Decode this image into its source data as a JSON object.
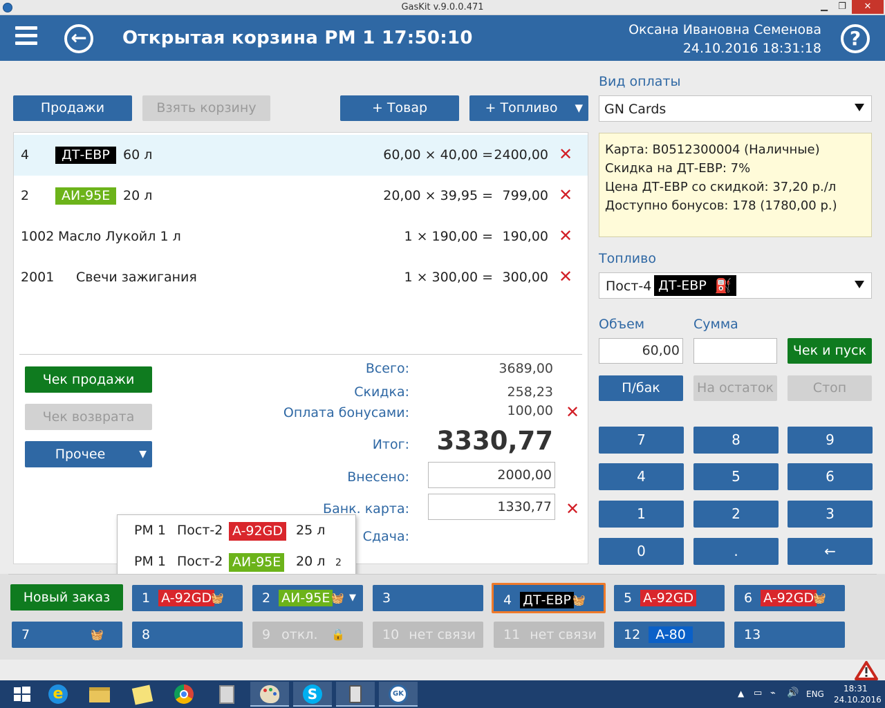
{
  "window": {
    "title": "GasKit v.9.0.0.471"
  },
  "header": {
    "title": "Открытая корзина  РМ 1  17:50:10",
    "user": "Оксана Ивановна Семенова",
    "datetime": "24.10.2016 18:31:18",
    "back_glyph": "←",
    "help_glyph": "?"
  },
  "toolbar": {
    "sales": "Продажи",
    "take_cart": "Взять корзину",
    "add_goods": "+ Товар",
    "add_fuel": "+ Топливо"
  },
  "cart": {
    "items": [
      {
        "code": "4",
        "badge": "ДТ-ЕВР",
        "name": "60 л",
        "calc": "60,00 × 40,00 =",
        "sum": "2400,00"
      },
      {
        "code": "2",
        "badge": "АИ-95Е",
        "name": "20 л",
        "calc": "20,00 × 39,95 =",
        "sum": "799,00"
      },
      {
        "code": "1002",
        "badge": "",
        "name": "Масло Лукойл 1 л",
        "calc": "1 × 190,00 =",
        "sum": "190,00"
      },
      {
        "code": "2001",
        "badge": "",
        "name": "Свечи зажигания",
        "calc": "1 × 300,00 =",
        "sum": "300,00"
      }
    ],
    "remove_glyph": "✕"
  },
  "actions": {
    "sale_receipt": "Чек продажи",
    "return_receipt": "Чек возврата",
    "other": "Прочее"
  },
  "totals": {
    "total_label": "Всего:",
    "total": "3689,00",
    "discount_label": "Скидка:",
    "discount": "258,23",
    "bonus_label": "Оплата бонусами:",
    "bonus": "100,00",
    "result_label": "Итог:",
    "result": "3330,77",
    "paid_label": "Внесено:",
    "paid": "2000,00",
    "card_label": "Банк. карта:",
    "card": "1330,77",
    "change_label": "Сдача:"
  },
  "popup": {
    "rows": [
      {
        "rm": "РМ 1",
        "post": "Пост-2",
        "fuel": "A-92GD",
        "vol": "25 л",
        "extra": ""
      },
      {
        "rm": "РМ 1",
        "post": "Пост-2",
        "fuel": "АИ-95Е",
        "vol": "20 л",
        "extra": "2"
      }
    ]
  },
  "payment": {
    "label": "Вид оплаты",
    "selected": "GN Cards",
    "info": [
      "Карта: B0512300004 (Наличные)",
      "Скидка на ДТ-ЕВР: 7%",
      "Цена ДТ-ЕВР со скидкой: 37,20 р./л",
      "Доступно бонусов: 178 (1780,00 р.)"
    ]
  },
  "fuel": {
    "label": "Топливо",
    "post": "Пост-4",
    "badge": "ДТ-ЕВР",
    "volume_label": "Объем",
    "sum_label": "Сумма",
    "volume": "60,00",
    "sum": "",
    "start": "Чек и пуск",
    "full_tank": "П/бак",
    "remainder": "На остаток",
    "stop": "Стоп"
  },
  "keypad": [
    "7",
    "8",
    "9",
    "4",
    "5",
    "6",
    "1",
    "2",
    "3",
    "0",
    ".",
    "←"
  ],
  "pumps": {
    "new_order": "Новый заказ",
    "items": [
      {
        "num": "1",
        "fuel": "A-92GD",
        "status": ""
      },
      {
        "num": "2",
        "fuel": "АИ-95Е",
        "status": ""
      },
      {
        "num": "3",
        "fuel": "",
        "status": ""
      },
      {
        "num": "4",
        "fuel": "ДТ-ЕВР",
        "status": ""
      },
      {
        "num": "5",
        "fuel": "A-92GD",
        "status": ""
      },
      {
        "num": "6",
        "fuel": "A-92GD",
        "status": ""
      },
      {
        "num": "7",
        "fuel": "",
        "status": ""
      },
      {
        "num": "8",
        "fuel": "",
        "status": ""
      },
      {
        "num": "9",
        "fuel": "",
        "status": "откл."
      },
      {
        "num": "10",
        "fuel": "",
        "status": "нет связи"
      },
      {
        "num": "11",
        "fuel": "",
        "status": "нет связи"
      },
      {
        "num": "12",
        "fuel": "A-80",
        "status": ""
      },
      {
        "num": "13",
        "fuel": "",
        "status": ""
      }
    ]
  },
  "taskbar": {
    "lang": "ENG",
    "time": "18:31",
    "date": "24.10.2016"
  },
  "colors": {
    "accent": "#2f68a4",
    "green": "#0f7b1f",
    "danger": "#d21f27"
  }
}
